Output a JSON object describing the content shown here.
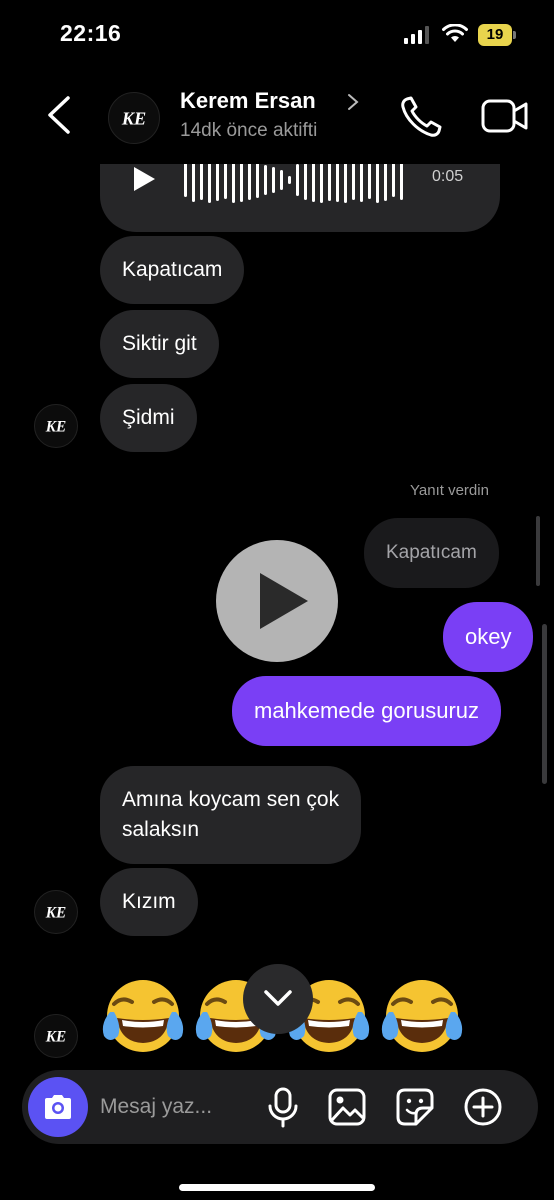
{
  "status_bar": {
    "time": "22:16",
    "battery": "19",
    "battery_color": "#e8d44d"
  },
  "header": {
    "contact_name": "Kerem Ersan",
    "contact_status": "14dk önce aktifti",
    "avatar_monogram": "KE"
  },
  "messages": {
    "voice_duration": "0:05",
    "incoming_1": "Kapatıcam",
    "incoming_2": "Siktir git",
    "incoming_3": "Şidmi",
    "reply_label": "Yanıt verdin",
    "replied_to": "Kapatıcam",
    "outgoing_1": "okey",
    "outgoing_2": "mahkemede gorusuruz",
    "incoming_4_line1": "Amına koycam sen çok",
    "incoming_4_line2": "salaksın",
    "incoming_5": "Kızım",
    "emoji_count": 4,
    "emoji": "face-with-tears-of-joy"
  },
  "composer": {
    "placeholder": "Mesaj yaz..."
  },
  "colors": {
    "outgoing_bubble": "#7a3ff5",
    "incoming_bubble": "#262628",
    "camera_button": "#5b52f3"
  }
}
